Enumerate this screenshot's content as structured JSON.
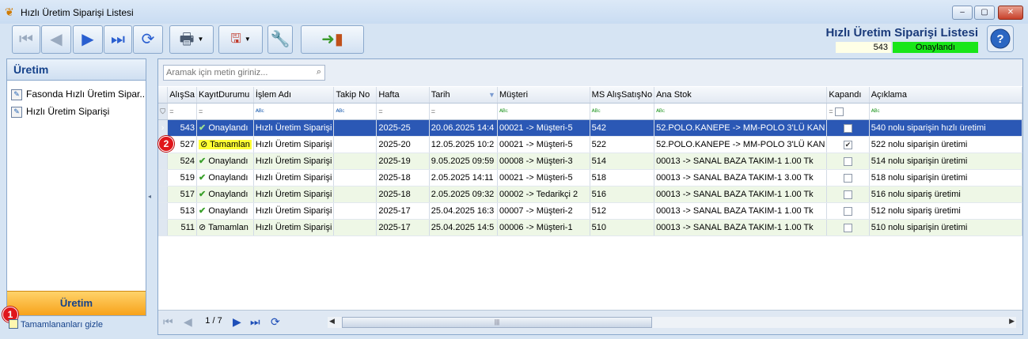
{
  "window": {
    "title": "Hızlı Üretim Siparişi Listesi"
  },
  "header": {
    "title": "Hızlı Üretim Siparişi Listesi",
    "record_number": "543",
    "record_status": "Onaylandı"
  },
  "left_panel": {
    "title": "Üretim",
    "items": [
      {
        "label": "Fasonda Hızlı Üretim Sipar..."
      },
      {
        "label": "Hızlı Üretim Siparişi"
      }
    ],
    "footer": "Üretim",
    "hide_completed_label": "Tamamlananları gizle"
  },
  "badges": {
    "one": "1",
    "two": "2"
  },
  "grid": {
    "search_placeholder": "Aramak için metin giriniz...",
    "columns": [
      "AlışSa",
      "KayıtDurumu",
      "İşlem Adı",
      "Takip No",
      "Hafta",
      "Tarih",
      "Müşteri",
      "MS AlışSatışNo",
      "Ana Stok",
      "Kapandı",
      "Açıklama"
    ],
    "rows": [
      {
        "no": "543",
        "status": "Onaylandı",
        "status_icon": "check-icon",
        "islem": "Hızlı Üretim Siparişi",
        "takip": "",
        "hafta": "2025-25",
        "tarih": "20.06.2025 14:4",
        "musteri": "00021 -> Müşteri-5",
        "ms": "542",
        "stok": "52.POLO.KANEPE -> MM-POLO 3'LÜ KAN",
        "kapandi": "",
        "aciklama": "540 nolu siparişin hızlı üretimi"
      },
      {
        "no": "527",
        "status": "Tamamlan",
        "status_icon": "clock-check-icon",
        "islem": "Hızlı Üretim Siparişi",
        "takip": "",
        "hafta": "2025-20",
        "tarih": "12.05.2025 10:2",
        "musteri": "00021 -> Müşteri-5",
        "ms": "522",
        "stok": "52.POLO.KANEPE -> MM-POLO 3'LÜ KAN",
        "kapandi": "✔",
        "aciklama": "522 nolu siparişin üretimi"
      },
      {
        "no": "524",
        "status": "Onaylandı",
        "status_icon": "check-icon",
        "islem": "Hızlı Üretim Siparişi",
        "takip": "",
        "hafta": "2025-19",
        "tarih": "9.05.2025 09:59",
        "musteri": "00008 -> Müşteri-3",
        "ms": "514",
        "stok": "00013 -> SANAL BAZA TAKIM-1 1.00 Tk",
        "kapandi": "",
        "aciklama": "514 nolu siparişin üretimi"
      },
      {
        "no": "519",
        "status": "Onaylandı",
        "status_icon": "check-icon",
        "islem": "Hızlı Üretim Siparişi",
        "takip": "",
        "hafta": "2025-18",
        "tarih": "2.05.2025 14:11",
        "musteri": "00021 -> Müşteri-5",
        "ms": "518",
        "stok": "00013 -> SANAL BAZA TAKIM-1 3.00 Tk",
        "kapandi": "",
        "aciklama": "518 nolu siparişin üretimi"
      },
      {
        "no": "517",
        "status": "Onaylandı",
        "status_icon": "check-icon",
        "islem": "Hızlı Üretim Siparişi",
        "takip": "",
        "hafta": "2025-18",
        "tarih": "2.05.2025 09:32",
        "musteri": "00002 -> Tedarikçi 2",
        "ms": "516",
        "stok": "00013 -> SANAL BAZA TAKIM-1 1.00 Tk",
        "kapandi": "",
        "aciklama": "516 nolu sipariş üretimi"
      },
      {
        "no": "513",
        "status": "Onaylandı",
        "status_icon": "check-icon",
        "islem": "Hızlı Üretim Siparişi",
        "takip": "",
        "hafta": "2025-17",
        "tarih": "25.04.2025 16:3",
        "musteri": "00007 -> Müşteri-2",
        "ms": "512",
        "stok": "00013 -> SANAL BAZA TAKIM-1 1.00 Tk",
        "kapandi": "",
        "aciklama": "512 nolu sipariş üretimi"
      },
      {
        "no": "511",
        "status": "Tamamlan",
        "status_icon": "clock-check-icon",
        "islem": "Hızlı Üretim Siparişi",
        "takip": "",
        "hafta": "2025-17",
        "tarih": "25.04.2025 14:5",
        "musteri": "00006 -> Müşteri-1",
        "ms": "510",
        "stok": "00013 -> SANAL BAZA TAKIM-1 1.00 Tk",
        "kapandi": "",
        "aciklama": "510 nolu siparişin üretimi"
      }
    ],
    "pager": "1 / 7"
  },
  "colors": {
    "accent": "#15428b",
    "selection": "#2b58b5",
    "approved": "#19e619",
    "highlight": "#ffff33"
  }
}
